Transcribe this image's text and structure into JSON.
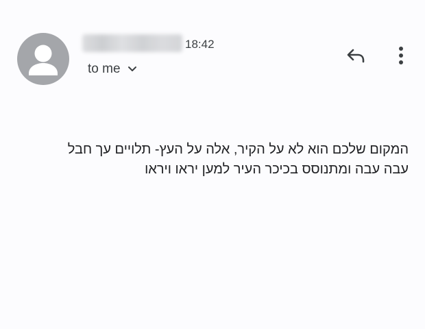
{
  "header": {
    "time": "18:42",
    "recipient_label": "to me"
  },
  "icons": {
    "avatar": "person-icon",
    "recipient_toggle": "chevron-down-icon",
    "reply": "reply-icon",
    "more": "more-vert-icon"
  },
  "colors": {
    "avatar_bg": "#a4a6aa",
    "icon": "#3c4043",
    "text": "#202124"
  },
  "message": {
    "lines": [
      "המקום שלכם הוא לא על הקיר, אלה על העץ- תלויים עך חבל",
      "עבה עבה ומתנוסס בכיכר העיר למען יראו ויראו"
    ]
  }
}
